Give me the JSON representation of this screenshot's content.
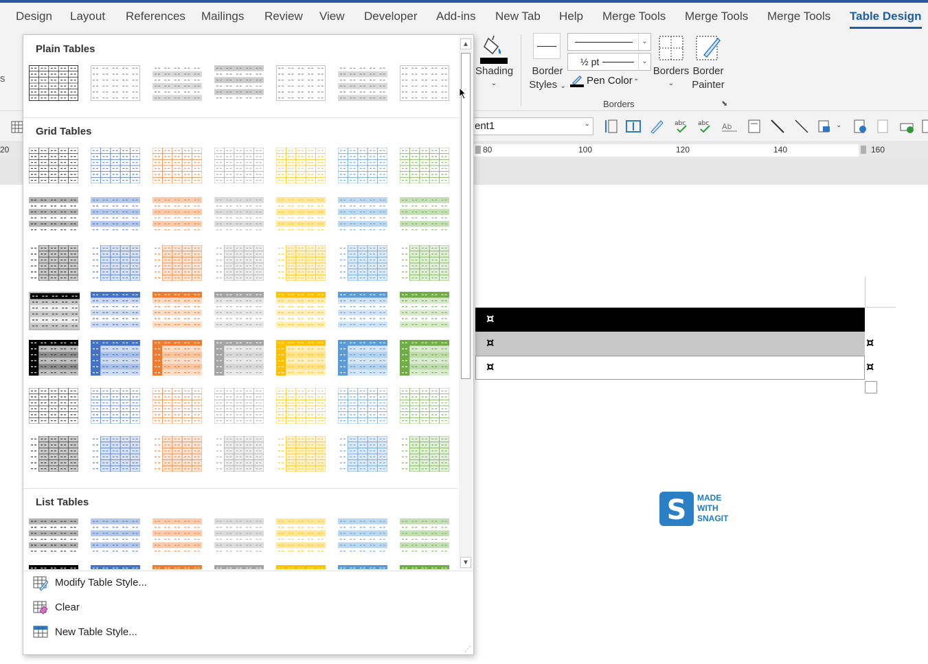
{
  "menu": {
    "tabs": [
      {
        "label": "Design"
      },
      {
        "label": "Layout"
      },
      {
        "label": "References"
      },
      {
        "label": "Mailings"
      },
      {
        "label": "Review"
      },
      {
        "label": "View"
      },
      {
        "label": "Developer"
      },
      {
        "label": "Add-ins"
      },
      {
        "label": "New Tab"
      },
      {
        "label": "Help"
      },
      {
        "label": "Merge Tools"
      },
      {
        "label": "Merge Tools"
      },
      {
        "label": "Merge Tools"
      },
      {
        "label": "Table Design"
      }
    ],
    "active_tab": "Table Design"
  },
  "ribbon": {
    "shading_label": "Shading",
    "border_styles_line1": "Border",
    "border_styles_line2": "Styles",
    "pen_weight_value": "½ pt",
    "pen_color_label": "Pen Color",
    "borders_label": "Borders",
    "border_painter_line1": "Border",
    "border_painter_line2": "Painter",
    "group_borders_label": "Borders"
  },
  "toolbar": {
    "style_value": "ent1"
  },
  "ruler": {
    "labels": [
      "20",
      "80",
      "100",
      "120",
      "140",
      "160"
    ]
  },
  "gallery": {
    "sections": [
      {
        "title": "Plain Tables"
      },
      {
        "title": "Grid Tables"
      },
      {
        "title": "List Tables"
      }
    ],
    "actions": [
      {
        "label": "Modify Table Style...",
        "icon": "modify-table-style-icon"
      },
      {
        "label": "Clear",
        "icon": "clear-table-style-icon"
      },
      {
        "label": "New Table Style...",
        "icon": "new-table-style-icon"
      }
    ],
    "palette": {
      "black": "#000000",
      "blue": "#4472c4",
      "orange": "#ed7d31",
      "gray": "#a5a5a5",
      "gold": "#ffc000",
      "lightblue": "#5b9bd5",
      "green": "#70ad47"
    }
  },
  "document": {
    "cell_mark": "¤",
    "header_color": "#000000",
    "banded_color": "#c8c8c8"
  },
  "watermark": {
    "line1": "MADE",
    "line2": "WITH",
    "line3": "SNAGIT"
  }
}
